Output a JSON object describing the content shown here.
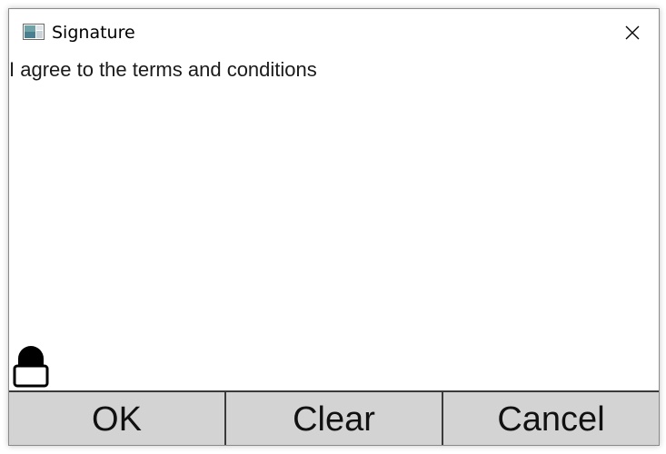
{
  "window": {
    "title": "Signature"
  },
  "content": {
    "prompt": "I agree to the terms and conditions"
  },
  "buttons": {
    "ok_label": "OK",
    "clear_label": "Clear",
    "cancel_label": "Cancel"
  },
  "icons": {
    "app": "app-window-icon",
    "close": "close-icon",
    "lock": "lock-icon"
  },
  "colors": {
    "button_background": "#d3d3d3",
    "button_border": "#3a3a3a",
    "window_background": "#ffffff"
  }
}
